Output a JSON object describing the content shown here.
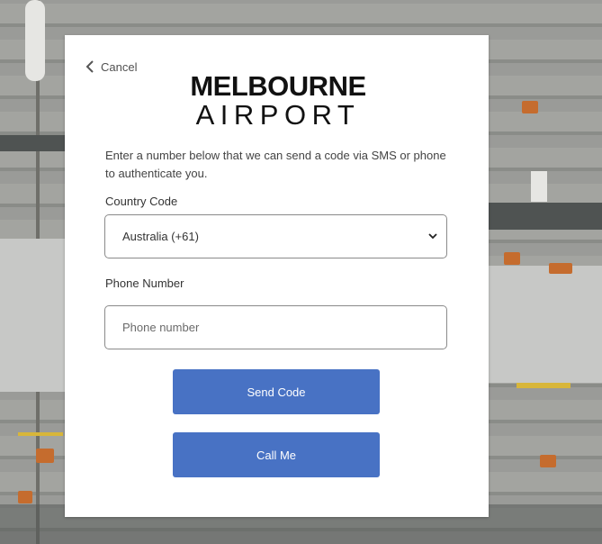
{
  "cancel": {
    "label": "Cancel",
    "icon": "chevron-left-icon"
  },
  "logo": {
    "line1": "MELBOURNE",
    "line2": "AIRPORT"
  },
  "intro_text": "Enter a number below that we can send a code via SMS or phone to authenticate you.",
  "country": {
    "label": "Country Code",
    "value": "Australia (+61)"
  },
  "phone": {
    "label": "Phone Number",
    "placeholder": "Phone number"
  },
  "buttons": {
    "send_code": "Send Code",
    "call_me": "Call Me"
  },
  "colors": {
    "button": "#4872c4",
    "card": "#ffffff"
  }
}
